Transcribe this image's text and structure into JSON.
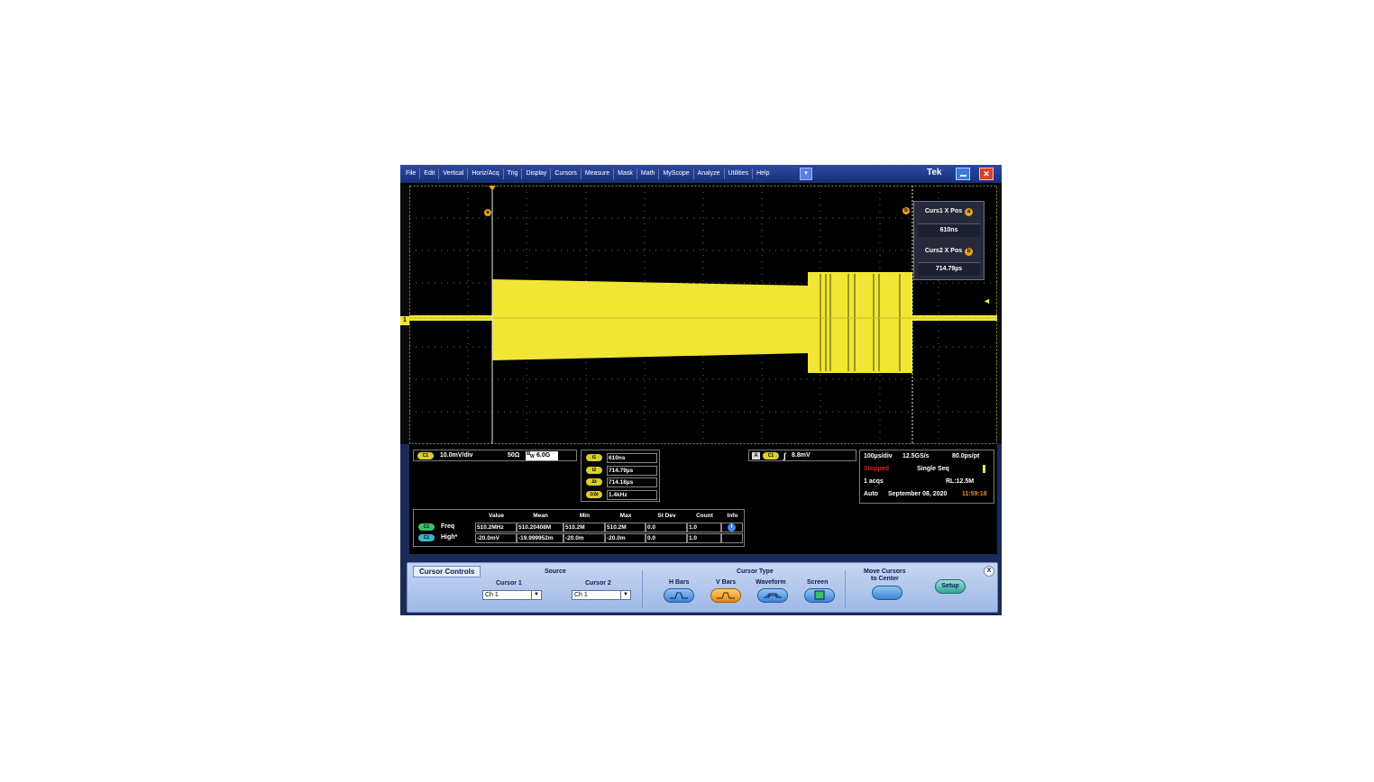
{
  "menu": {
    "items": [
      "File",
      "Edit",
      "Vertical",
      "Horiz/Acq",
      "Trig",
      "Display",
      "Cursors",
      "Measure",
      "Mask",
      "Math",
      "MyScope",
      "Analyze",
      "Utilities",
      "Help"
    ],
    "brand": "Tek",
    "dropdown_glyph": "▾",
    "close_glyph": "✕"
  },
  "markers": {
    "channel": "1",
    "cursor_a": "a",
    "cursor_b": "b"
  },
  "cursor_readout": {
    "curs1_label": "Curs1 X Pos",
    "curs1_value": "610ns",
    "curs2_label": "Curs2 X Pos",
    "curs2_value": "714.79µs"
  },
  "channel_panel": {
    "badge": "C1",
    "scale": "10.0mV/div",
    "impedance": "50Ω",
    "bw_prefix": "B",
    "bw_sub": "W",
    "bandwidth": "6.0G"
  },
  "cursor_values": [
    {
      "badge": "t1",
      "value": "610ns"
    },
    {
      "badge": "t2",
      "value": "714.79µs"
    },
    {
      "badge": "Δt",
      "value": "714.18µs"
    },
    {
      "badge": "1/Δt",
      "value": "1.4kHz"
    }
  ],
  "trigger_panel": {
    "badge_a": "A",
    "badge_ch": "C1",
    "slope_glyph": "∫",
    "level": "8.8mV"
  },
  "acq_panel": {
    "timebase": "100µs/div",
    "sample_rate": "12.5GS/s",
    "resolution": "80.0ps/pt",
    "state": "Stopped",
    "mode": "Single Seq",
    "acqs": "1 acqs",
    "record_length": "RL:12.5M",
    "trigger_mode": "Auto",
    "date": "September 08, 2020",
    "time": "11:59:18"
  },
  "measurements": {
    "headers": [
      "Value",
      "Mean",
      "Min",
      "Max",
      "St Dev",
      "Count",
      "Info"
    ],
    "rows": [
      {
        "badge": "C1",
        "name": "Freq",
        "cells": [
          "510.2MHz",
          "510.20408M",
          "510.2M",
          "510.2M",
          "0.0",
          "1.0",
          ""
        ]
      },
      {
        "badge": "C1",
        "name": "High*",
        "cells": [
          "-20.0mV",
          "-19.999952m",
          "-20.0m",
          "-20.0m",
          "0.0",
          "1.0",
          ""
        ]
      }
    ],
    "info_glyph": "i"
  },
  "controls": {
    "title": "Cursor Controls",
    "source_label": "Source",
    "cursor1_label": "Cursor 1",
    "cursor1_value": "Ch 1",
    "cursor2_label": "Cursor 2",
    "cursor2_value": "Ch 1",
    "select_arrow": "▼",
    "type_label": "Cursor Type",
    "types": [
      "H Bars",
      "V Bars",
      "Waveform",
      "Screen"
    ],
    "selected_type": "V Bars",
    "move_label_1": "Move Cursors",
    "move_label_2": "to Center",
    "setup_label": "Setup",
    "close_glyph": "X"
  },
  "colors": {
    "waveform": "#f1e634",
    "cursor": "#e8a11e",
    "stopped": "#e02020",
    "time": "#f08a1a"
  }
}
